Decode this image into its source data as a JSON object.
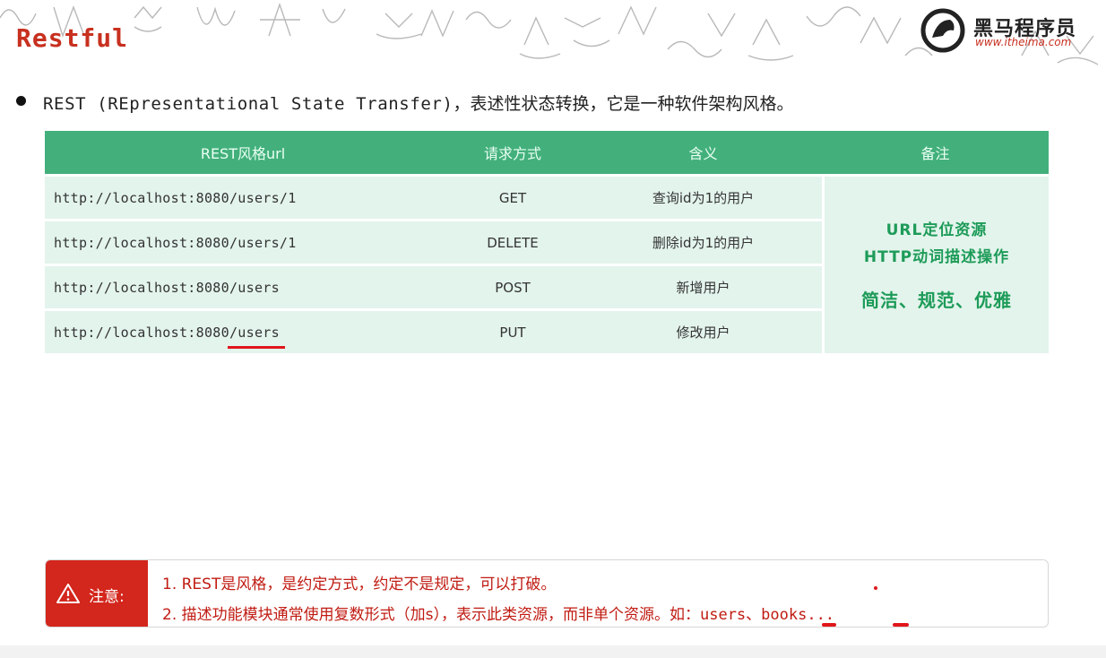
{
  "slide": {
    "title": "Restful",
    "brand_name": "黑马程序员",
    "brand_url": "www.itheima.com"
  },
  "bullet": {
    "prefix": "REST (REpresentational State Transfer)",
    "text": "，表述性状态转换，它是一种软件架构风格。"
  },
  "table": {
    "headers": [
      "REST风格url",
      "请求方式",
      "含义",
      "备注"
    ],
    "rows": [
      {
        "url": "http://localhost:8080/users/1",
        "method": "GET",
        "meaning": "查询id为1的用户"
      },
      {
        "url": "http://localhost:8080/users/1",
        "method": "DELETE",
        "meaning": "删除id为1的用户"
      },
      {
        "url": "http://localhost:8080/users",
        "method": "POST",
        "meaning": "新增用户"
      },
      {
        "url_prefix": "http://localhost:8080",
        "url_tail": "/users",
        "method": "PUT",
        "meaning": "修改用户"
      }
    ],
    "note": {
      "line1": "URL定位资源",
      "line2": "HTTP动词描述操作",
      "line3": "简洁、规范、优雅"
    }
  },
  "notice": {
    "title": "注意:",
    "line1": "1. REST是风格，是约定方式，约定不是规定，可以打破。",
    "line2_text": "2. 描述功能模块通常使用复数形式（加s），表示此类资源，而非单个资源。如：",
    "line2_example": "users、books..."
  },
  "colors": {
    "header_green": "#43b07c",
    "row_green": "#e3f4ec",
    "note_green": "#1d9b58",
    "accent_red": "#d3261c"
  }
}
